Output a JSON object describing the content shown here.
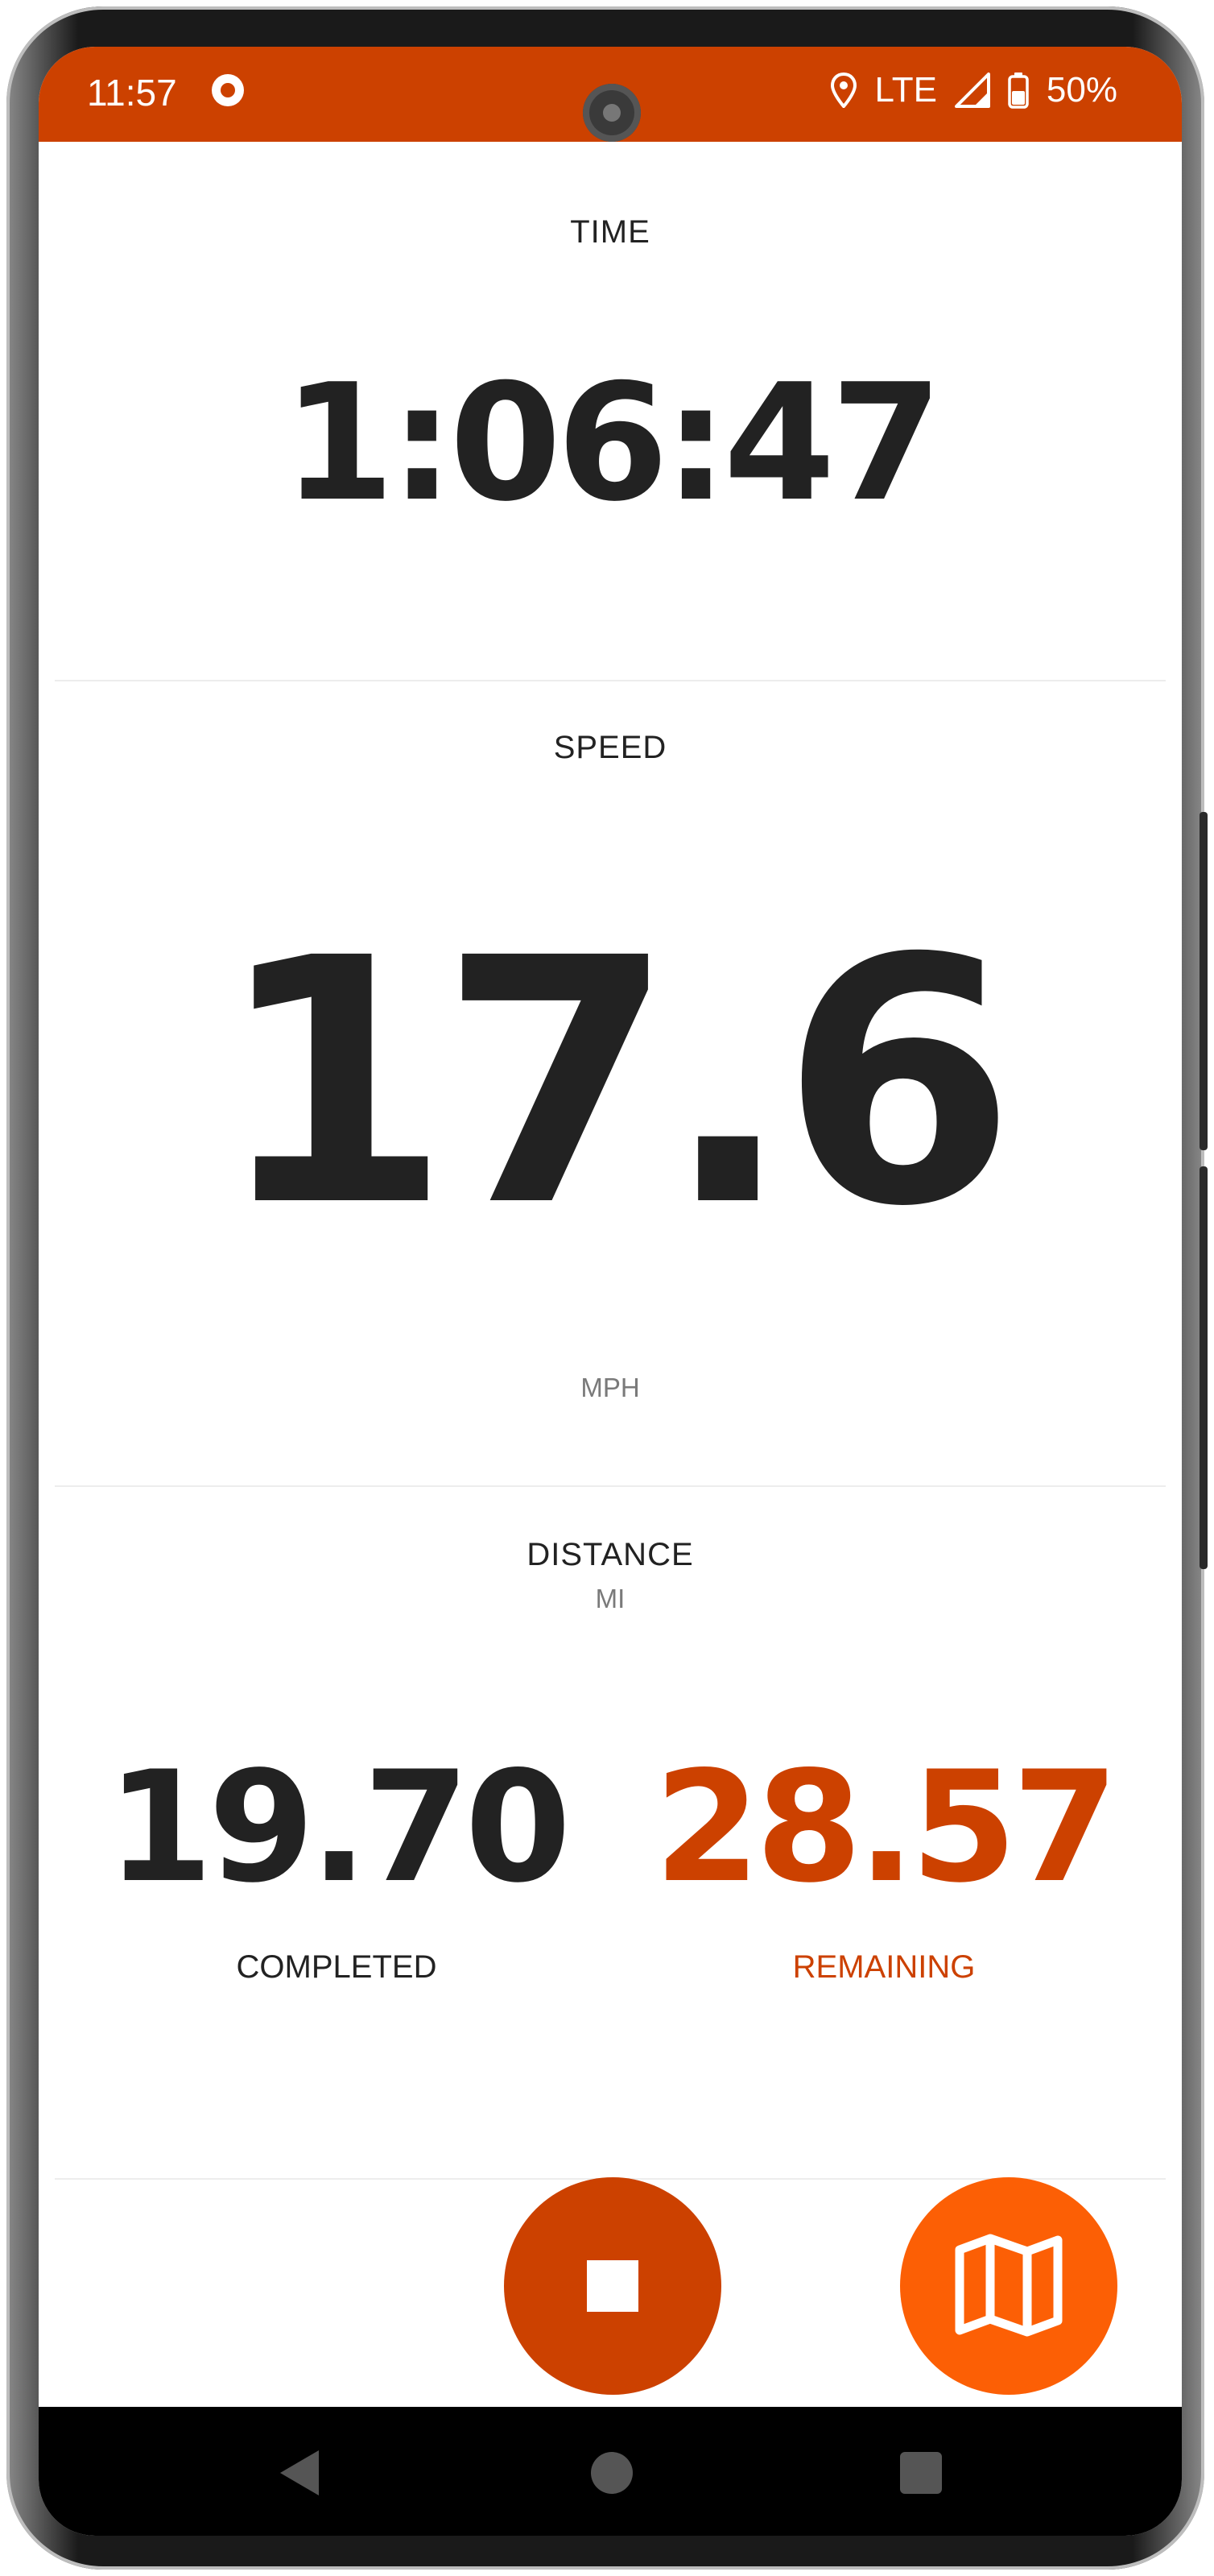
{
  "status_bar": {
    "time": "11:57",
    "network": "LTE",
    "battery": "50%",
    "icons": [
      "record-icon",
      "location-icon",
      "signal-icon",
      "battery-icon"
    ],
    "background_color": "#cc4100"
  },
  "time_section": {
    "label": "TIME",
    "value": "1:06:47"
  },
  "speed_section": {
    "label": "SPEED",
    "value": "17.6",
    "unit": "MPH"
  },
  "distance_section": {
    "label": "DISTANCE",
    "unit": "MI",
    "completed": {
      "value": "19.70",
      "label": "COMPLETED",
      "color": "#222222"
    },
    "remaining": {
      "value": "28.57",
      "label": "REMAINING",
      "color": "#cc4100"
    }
  },
  "actions": {
    "stop": {
      "icon": "stop-icon",
      "color": "#cc4100"
    },
    "map": {
      "icon": "map-icon",
      "color": "#fc5f05"
    }
  },
  "nav_bar": {
    "icons": [
      "back-icon",
      "home-icon",
      "recents-icon"
    ]
  }
}
